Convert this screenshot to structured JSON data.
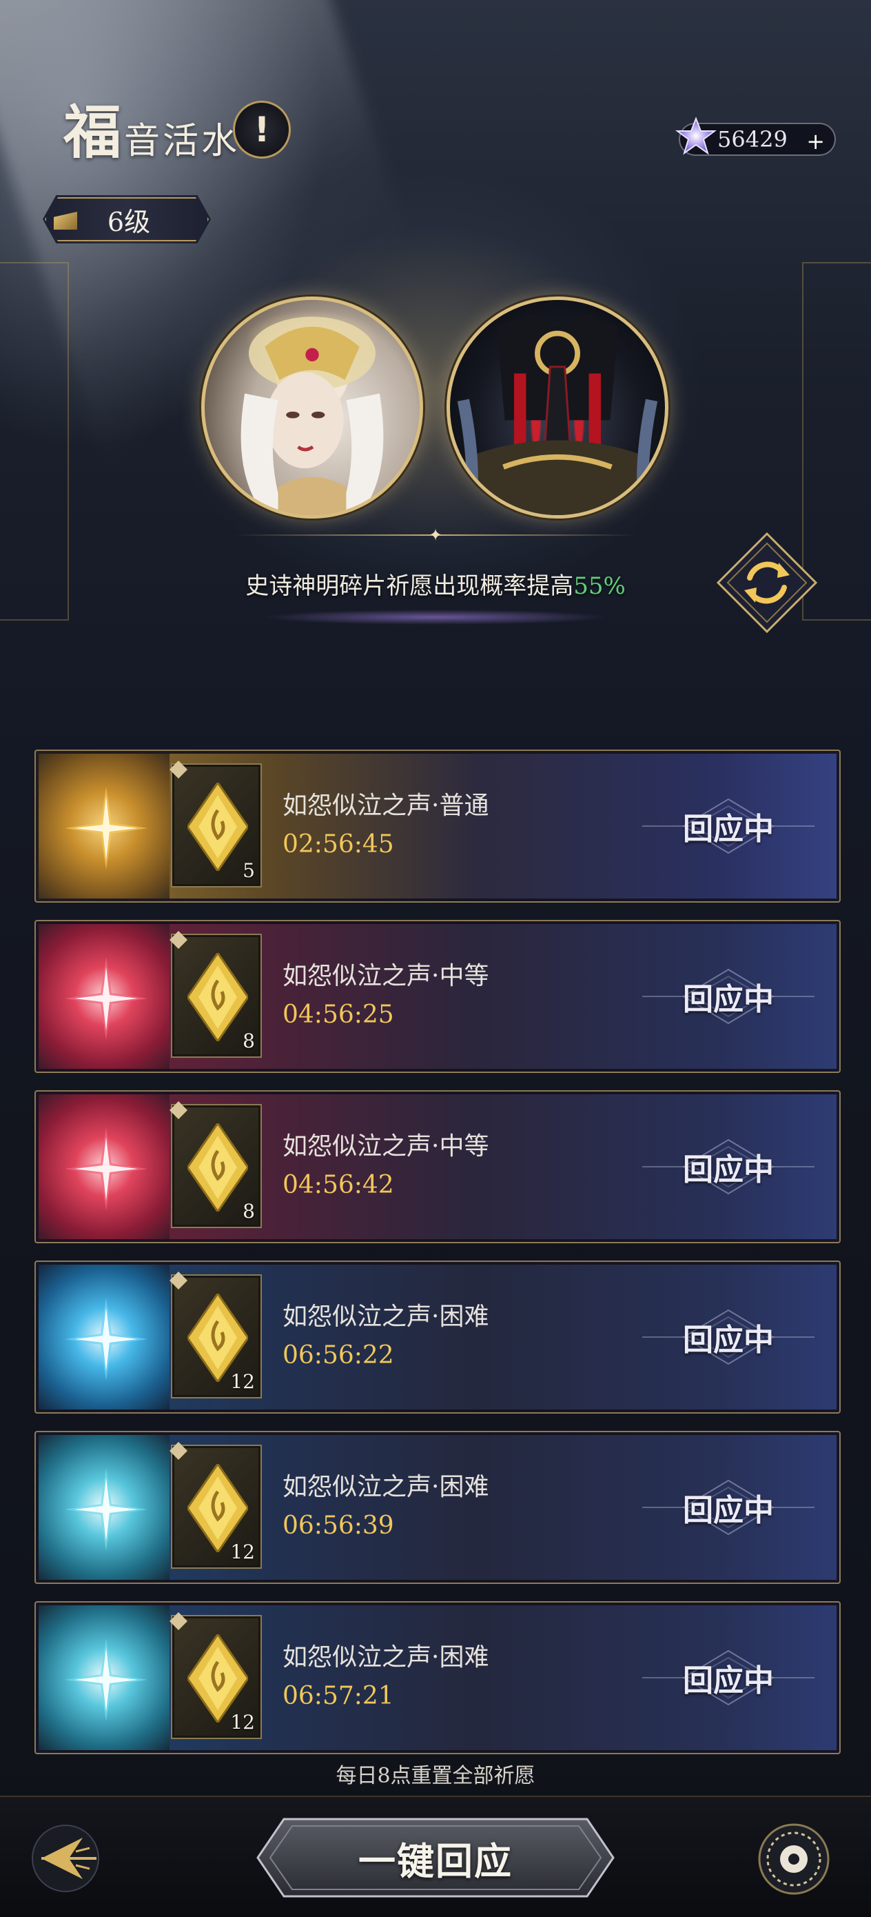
{
  "header": {
    "title_big": "福",
    "title_small": "音活水",
    "info_label": "!",
    "level": "6级",
    "currency_value": "56429",
    "currency_add": "+"
  },
  "banner": {
    "boost_text_prefix": "史诗神明碎片祈愿出现概率提高",
    "boost_value": "55%"
  },
  "wishes": [
    {
      "name": "如怨似泣之声·普通",
      "timer": "02:56:45",
      "qty": "5",
      "action": "回应中",
      "tier": "gold"
    },
    {
      "name": "如怨似泣之声·中等",
      "timer": "04:56:25",
      "qty": "8",
      "action": "回应中",
      "tier": "red"
    },
    {
      "name": "如怨似泣之声·中等",
      "timer": "04:56:42",
      "qty": "8",
      "action": "回应中",
      "tier": "red"
    },
    {
      "name": "如怨似泣之声·困难",
      "timer": "06:56:22",
      "qty": "12",
      "action": "回应中",
      "tier": "blue"
    },
    {
      "name": "如怨似泣之声·困难",
      "timer": "06:56:39",
      "qty": "12",
      "action": "回应中",
      "tier": "teal"
    },
    {
      "name": "如怨似泣之声·困难",
      "timer": "06:57:21",
      "qty": "12",
      "action": "回应中",
      "tier": "teal"
    }
  ],
  "footer": {
    "reset_note": "每日8点重置全部祈愿",
    "main_button": "一键回应"
  },
  "colors": {
    "accent_gold": "#d8bd7f",
    "timer_gold": "#f1c75a",
    "highlight_green": "#5fd07a"
  },
  "icons": {
    "back": "back-arrow-icon",
    "settings": "gear-icon",
    "refresh": "refresh-icon",
    "currency": "star-gem-icon"
  }
}
